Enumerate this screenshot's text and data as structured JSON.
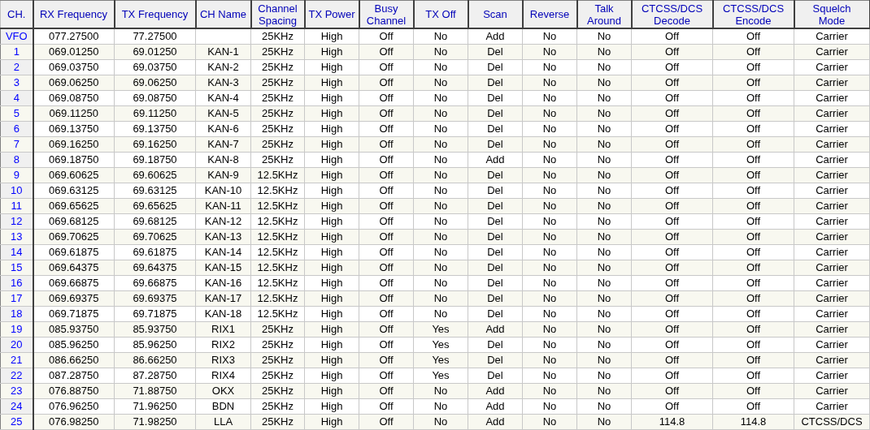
{
  "table": {
    "columns": [
      "CH.",
      "RX Frequency",
      "TX Frequency",
      "CH Name",
      "Channel\nSpacing",
      "TX Power",
      "Busy\nChannel",
      "TX Off",
      "Scan",
      "Reverse",
      "Talk\nAround",
      "CTCSS/DCS\nDecode",
      "CTCSS/DCS\nEncode",
      "Squelch\nMode"
    ],
    "rows": [
      [
        "VFO",
        "077.27500",
        "77.27500",
        null,
        "25KHz",
        "High",
        "Off",
        "No",
        "Add",
        "No",
        "No",
        "Off",
        "Off",
        "Carrier"
      ],
      [
        "1",
        "069.01250",
        "69.01250",
        "KAN-1",
        "25KHz",
        "High",
        "Off",
        "No",
        "Del",
        "No",
        "No",
        "Off",
        "Off",
        "Carrier"
      ],
      [
        "2",
        "069.03750",
        "69.03750",
        "KAN-2",
        "25KHz",
        "High",
        "Off",
        "No",
        "Del",
        "No",
        "No",
        "Off",
        "Off",
        "Carrier"
      ],
      [
        "3",
        "069.06250",
        "69.06250",
        "KAN-3",
        "25KHz",
        "High",
        "Off",
        "No",
        "Del",
        "No",
        "No",
        "Off",
        "Off",
        "Carrier"
      ],
      [
        "4",
        "069.08750",
        "69.08750",
        "KAN-4",
        "25KHz",
        "High",
        "Off",
        "No",
        "Del",
        "No",
        "No",
        "Off",
        "Off",
        "Carrier"
      ],
      [
        "5",
        "069.11250",
        "69.11250",
        "KAN-5",
        "25KHz",
        "High",
        "Off",
        "No",
        "Del",
        "No",
        "No",
        "Off",
        "Off",
        "Carrier"
      ],
      [
        "6",
        "069.13750",
        "69.13750",
        "KAN-6",
        "25KHz",
        "High",
        "Off",
        "No",
        "Del",
        "No",
        "No",
        "Off",
        "Off",
        "Carrier"
      ],
      [
        "7",
        "069.16250",
        "69.16250",
        "KAN-7",
        "25KHz",
        "High",
        "Off",
        "No",
        "Del",
        "No",
        "No",
        "Off",
        "Off",
        "Carrier"
      ],
      [
        "8",
        "069.18750",
        "69.18750",
        "KAN-8",
        "25KHz",
        "High",
        "Off",
        "No",
        "Add",
        "No",
        "No",
        "Off",
        "Off",
        "Carrier"
      ],
      [
        "9",
        "069.60625",
        "69.60625",
        "KAN-9",
        "12.5KHz",
        "High",
        "Off",
        "No",
        "Del",
        "No",
        "No",
        "Off",
        "Off",
        "Carrier"
      ],
      [
        "10",
        "069.63125",
        "69.63125",
        "KAN-10",
        "12.5KHz",
        "High",
        "Off",
        "No",
        "Del",
        "No",
        "No",
        "Off",
        "Off",
        "Carrier"
      ],
      [
        "11",
        "069.65625",
        "69.65625",
        "KAN-11",
        "12.5KHz",
        "High",
        "Off",
        "No",
        "Del",
        "No",
        "No",
        "Off",
        "Off",
        "Carrier"
      ],
      [
        "12",
        "069.68125",
        "69.68125",
        "KAN-12",
        "12.5KHz",
        "High",
        "Off",
        "No",
        "Del",
        "No",
        "No",
        "Off",
        "Off",
        "Carrier"
      ],
      [
        "13",
        "069.70625",
        "69.70625",
        "KAN-13",
        "12.5KHz",
        "High",
        "Off",
        "No",
        "Del",
        "No",
        "No",
        "Off",
        "Off",
        "Carrier"
      ],
      [
        "14",
        "069.61875",
        "69.61875",
        "KAN-14",
        "12.5KHz",
        "High",
        "Off",
        "No",
        "Del",
        "No",
        "No",
        "Off",
        "Off",
        "Carrier"
      ],
      [
        "15",
        "069.64375",
        "69.64375",
        "KAN-15",
        "12.5KHz",
        "High",
        "Off",
        "No",
        "Del",
        "No",
        "No",
        "Off",
        "Off",
        "Carrier"
      ],
      [
        "16",
        "069.66875",
        "69.66875",
        "KAN-16",
        "12.5KHz",
        "High",
        "Off",
        "No",
        "Del",
        "No",
        "No",
        "Off",
        "Off",
        "Carrier"
      ],
      [
        "17",
        "069.69375",
        "69.69375",
        "KAN-17",
        "12.5KHz",
        "High",
        "Off",
        "No",
        "Del",
        "No",
        "No",
        "Off",
        "Off",
        "Carrier"
      ],
      [
        "18",
        "069.71875",
        "69.71875",
        "KAN-18",
        "12.5KHz",
        "High",
        "Off",
        "No",
        "Del",
        "No",
        "No",
        "Off",
        "Off",
        "Carrier"
      ],
      [
        "19",
        "085.93750",
        "85.93750",
        "RIX1",
        "25KHz",
        "High",
        "Off",
        "Yes",
        "Add",
        "No",
        "No",
        "Off",
        "Off",
        "Carrier"
      ],
      [
        "20",
        "085.96250",
        "85.96250",
        "RIX2",
        "25KHz",
        "High",
        "Off",
        "Yes",
        "Del",
        "No",
        "No",
        "Off",
        "Off",
        "Carrier"
      ],
      [
        "21",
        "086.66250",
        "86.66250",
        "RIX3",
        "25KHz",
        "High",
        "Off",
        "Yes",
        "Del",
        "No",
        "No",
        "Off",
        "Off",
        "Carrier"
      ],
      [
        "22",
        "087.28750",
        "87.28750",
        "RIX4",
        "25KHz",
        "High",
        "Off",
        "Yes",
        "Del",
        "No",
        "No",
        "Off",
        "Off",
        "Carrier"
      ],
      [
        "23",
        "076.88750",
        "71.88750",
        "OKX",
        "25KHz",
        "High",
        "Off",
        "No",
        "Add",
        "No",
        "No",
        "Off",
        "Off",
        "Carrier"
      ],
      [
        "24",
        "076.96250",
        "71.96250",
        "BDN",
        "25KHz",
        "High",
        "Off",
        "No",
        "Add",
        "No",
        "No",
        "Off",
        "Off",
        "Carrier"
      ],
      [
        "25",
        "076.98250",
        "71.98250",
        "LLA",
        "25KHz",
        "High",
        "Off",
        "No",
        "Add",
        "No",
        "No",
        "114.8",
        "114.8",
        "CTCSS/DCS"
      ]
    ]
  }
}
